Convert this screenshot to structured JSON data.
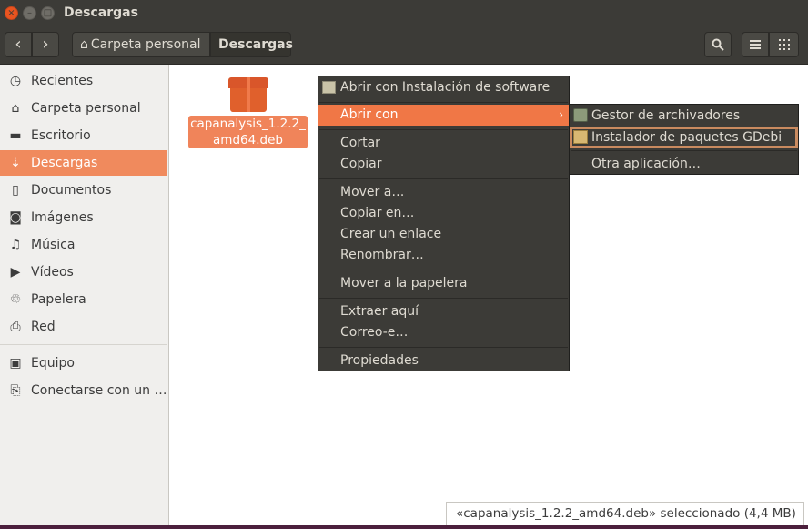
{
  "window": {
    "title": "Descargas",
    "close_glyph": "×",
    "min_glyph": "–",
    "max_glyph": "□"
  },
  "toolbar": {
    "back_glyph": "‹",
    "forward_glyph": "›",
    "home_icon": "⌂",
    "breadcrumb_home": "Carpeta personal",
    "breadcrumb_current": "Descargas",
    "search_glyph": "⌕",
    "list_glyph": "☰",
    "grid_glyph": "⁞⁞"
  },
  "sidebar": {
    "items": [
      {
        "label": "Recientes",
        "icon": "◷"
      },
      {
        "label": "Carpeta personal",
        "icon": "⌂"
      },
      {
        "label": "Escritorio",
        "icon": "▬"
      },
      {
        "label": "Descargas",
        "icon": "⇣"
      },
      {
        "label": "Documentos",
        "icon": "▯"
      },
      {
        "label": "Imágenes",
        "icon": "◙"
      },
      {
        "label": "Música",
        "icon": "♫"
      },
      {
        "label": "Vídeos",
        "icon": "▶"
      },
      {
        "label": "Papelera",
        "icon": "♲"
      },
      {
        "label": "Red",
        "icon": "⎙"
      },
      {
        "label": "Equipo",
        "icon": "▣"
      },
      {
        "label": "Conectarse con un …",
        "icon": "⎘"
      }
    ]
  },
  "file": {
    "name_line1": "capanalysis_1.2.2_",
    "name_line2": "amd64.deb"
  },
  "context_menu": {
    "items": [
      {
        "label": "Abrir con Instalación de software"
      },
      {
        "label": "Abrir con",
        "arrow": "›"
      },
      {
        "label": "Cortar"
      },
      {
        "label": "Copiar"
      },
      {
        "label": "Mover a…"
      },
      {
        "label": "Copiar en…"
      },
      {
        "label": "Crear un enlace"
      },
      {
        "label": "Renombrar…"
      },
      {
        "label": "Mover a la papelera"
      },
      {
        "label": "Extraer aquí"
      },
      {
        "label": "Correo-e…"
      },
      {
        "label": "Propiedades"
      }
    ]
  },
  "submenu": {
    "items": [
      {
        "label": "Gestor de archivadores"
      },
      {
        "label": "Instalador de paquetes GDebi"
      },
      {
        "label": "Otra aplicación…"
      }
    ]
  },
  "statusbar": {
    "text": "«capanalysis_1.2.2_amd64.deb» seleccionado  (4,4 MB)"
  }
}
